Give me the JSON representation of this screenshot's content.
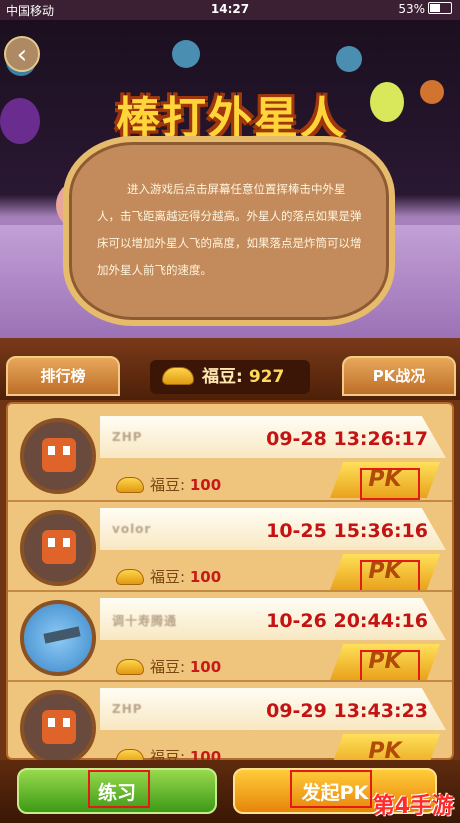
{
  "status_bar": {
    "carrier": "中国移动",
    "time": "14:27",
    "battery": "53%"
  },
  "game": {
    "title": "棒打外星人",
    "description": "进入游戏后点击屏幕任意位置挥棒击中外星人，击飞距离越远得分越高。外星人的落点如果是弹床可以增加外星人飞的高度，如果落点是炸筒可以增加外星人前飞的速度。"
  },
  "tabs": {
    "leaderboard": "排行榜",
    "pk_history": "PK战况"
  },
  "balance": {
    "label": "福豆:",
    "value": "927"
  },
  "entries": [
    {
      "name": "ZHP",
      "time": "09-28 13:26:17",
      "beans_label": "福豆:",
      "beans": "100",
      "pk_label": "PK"
    },
    {
      "name": "volor",
      "time": "10-25 15:36:16",
      "beans_label": "福豆:",
      "beans": "100",
      "pk_label": "PK"
    },
    {
      "name": "调十寿腾通",
      "time": "10-26 20:44:16",
      "beans_label": "福豆:",
      "beans": "100",
      "pk_label": "PK"
    },
    {
      "name": "ZHP",
      "time": "09-29 13:43:23",
      "beans_label": "福豆:",
      "beans": "100",
      "pk_label": "PK"
    }
  ],
  "footer": {
    "practice": "练习",
    "start_pk": "发起PK"
  },
  "watermark": "第4手游"
}
